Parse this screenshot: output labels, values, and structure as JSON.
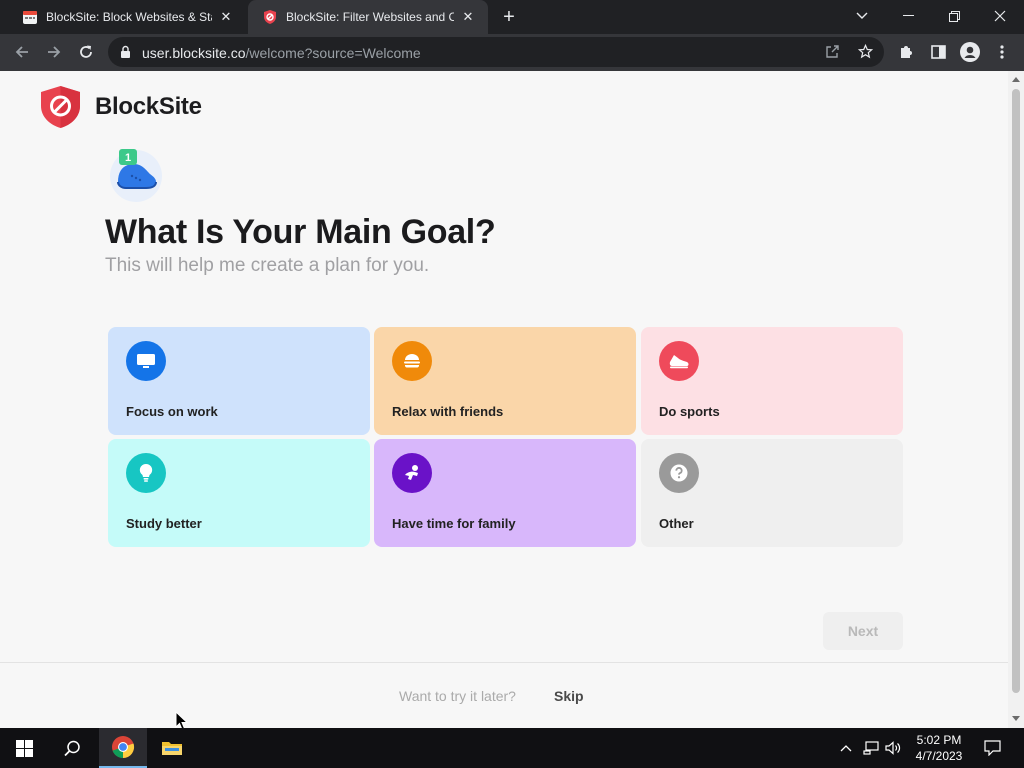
{
  "browser": {
    "tabs": [
      {
        "title": "BlockSite: Block Websites & Stay",
        "active": false
      },
      {
        "title": "BlockSite: Filter Websites and Co",
        "active": true
      }
    ],
    "new_tab_symbol": "+",
    "url": {
      "host": "user.blocksite.co",
      "path": "/welcome?source=Welcome"
    }
  },
  "page": {
    "brand": "BlockSite",
    "step_number": "1",
    "heading": "What Is Your Main Goal?",
    "subheading": "This will help me create a plan for you.",
    "goals": [
      {
        "label": "Focus on work",
        "icon": "monitor-icon",
        "card_color": "#cfe2fc",
        "icon_color": "#1474e8"
      },
      {
        "label": "Relax with friends",
        "icon": "burger-icon",
        "card_color": "#fad6a9",
        "icon_color": "#f08a0a"
      },
      {
        "label": "Do sports",
        "icon": "sneaker-icon",
        "card_color": "#fde0e4",
        "icon_color": "#ef4a5b"
      },
      {
        "label": "Study better",
        "icon": "lightbulb-icon",
        "card_color": "#c5fbf9",
        "icon_color": "#17c6c3"
      },
      {
        "label": "Have time for family",
        "icon": "family-icon",
        "card_color": "#d8b7fb",
        "icon_color": "#6a12c8"
      },
      {
        "label": "Other",
        "icon": "question-icon",
        "card_color": "#efefef",
        "icon_color": "#9a9a9a"
      }
    ],
    "next_label": "Next",
    "try_later": "Want to try it later?",
    "skip_label": "Skip"
  },
  "taskbar": {
    "time": "5:02 PM",
    "date": "4/7/2023"
  },
  "colors": {
    "brand_red": "#e8424e",
    "heading": "#1b1b1d",
    "subheading": "#a0a0a3"
  }
}
